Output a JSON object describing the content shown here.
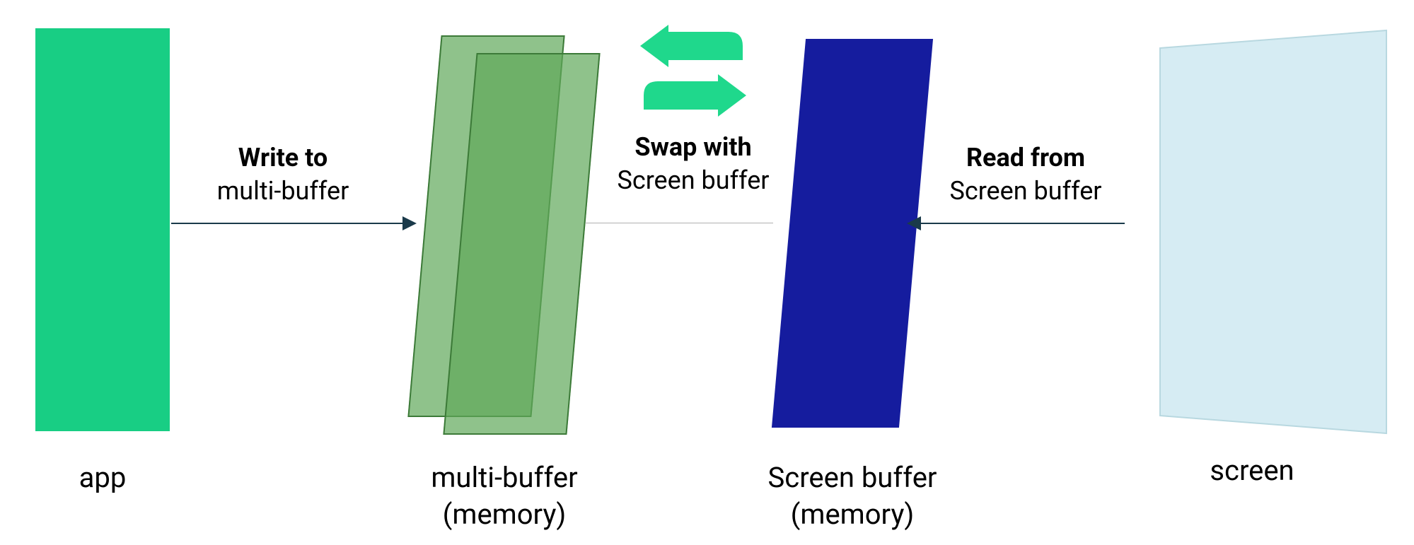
{
  "nodes": {
    "app": {
      "label": "app",
      "color": "#18CE84"
    },
    "multi_buffer": {
      "label_line1": "multi-buffer",
      "label_line2": "(memory)",
      "color": "rgba(95, 168, 90, 0.7)",
      "border": "#3c7a38"
    },
    "screen_buffer": {
      "label_line1": "Screen buffer",
      "label_line2": "(memory)",
      "color": "#151C9E"
    },
    "screen": {
      "label": "screen",
      "color": "#D6ECF3"
    }
  },
  "edges": {
    "write": {
      "bold": "Write to",
      "normal": "multi-buffer"
    },
    "swap": {
      "bold": "Swap with",
      "normal": "Screen buffer",
      "icon_color": "#1FD88C"
    },
    "read": {
      "bold": "Read from",
      "normal": "Screen buffer"
    }
  }
}
